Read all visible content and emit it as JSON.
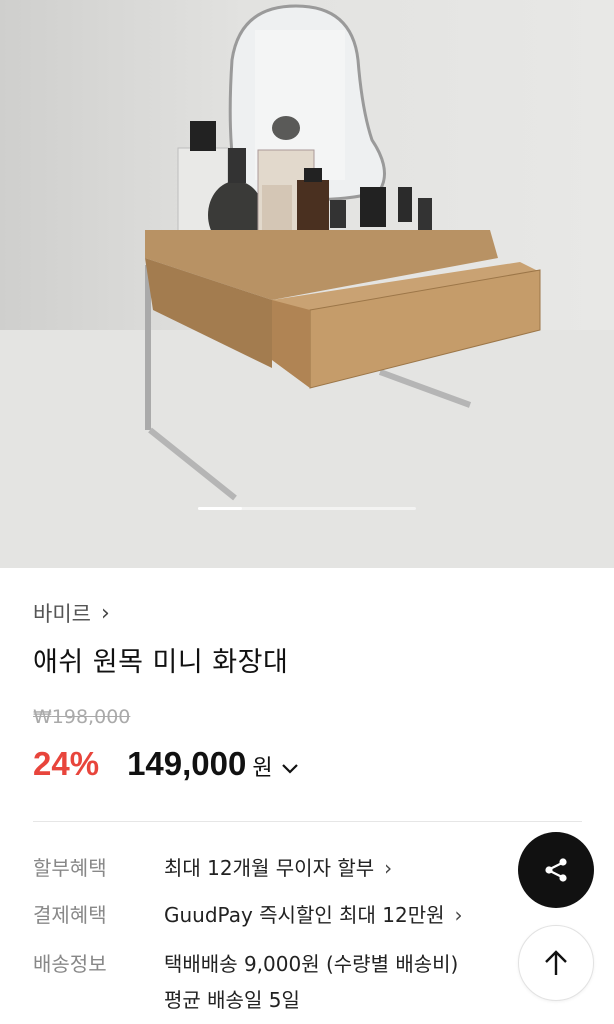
{
  "product": {
    "brand": "바미르",
    "title": "애쉬 원목 미니 화장대",
    "original_price": "198,000",
    "discount": "24%",
    "price": "149,000",
    "currency": "원"
  },
  "gallery": {
    "current_index": 1,
    "progress": 0.2
  },
  "info": [
    {
      "label": "할부혜택",
      "value": "최대 12개월 무이자 할부",
      "has_chevron": true
    },
    {
      "label": "결제혜택",
      "value": "GuudPay 즉시할인 최대 12만원",
      "has_chevron": true
    },
    {
      "label": "배송정보",
      "value": "택배배송 9,000원 (수량별 배송비)",
      "has_chevron": false
    },
    {
      "label": "",
      "value": "평균 배송일 5일",
      "has_chevron": false
    }
  ],
  "icons": {
    "brand_chevron": "chevron-right-icon",
    "price_chevron": "chevron-down-icon",
    "share": "share-icon",
    "scroll_top": "arrow-up-icon"
  },
  "colors": {
    "discount": "#e8453c",
    "share_button": "#111111"
  }
}
